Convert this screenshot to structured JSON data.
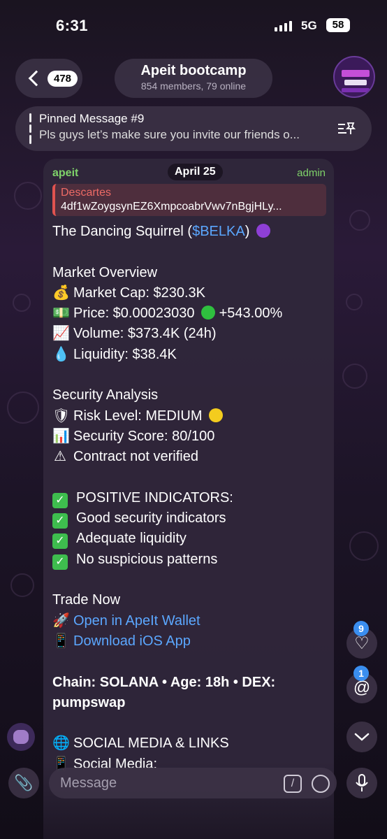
{
  "status_bar": {
    "time": "6:31",
    "network": "5G",
    "battery": "58"
  },
  "header": {
    "back_count": "478",
    "title": "Apeit bootcamp",
    "subtitle": "854 members, 79 online"
  },
  "pinned": {
    "title": "Pinned Message #9",
    "text": "Pls guys let’s make sure you invite our friends o..."
  },
  "message": {
    "sender": "apeit",
    "date": "April 25",
    "role": "admin",
    "reply": {
      "name": "Descartes",
      "text": "4df1wZoygsynEZ6XmpcoabrVwv7nBgjHLy..."
    },
    "token_title_prefix": "The Dancing Squirrel (",
    "token_ticker": "$BELKA",
    "token_title_suffix": ") ",
    "market_heading": "Market Overview",
    "market_cap": "Market Cap: $230.3K",
    "price": "Price: $0.00023030",
    "price_change": "+543.00%",
    "volume": "Volume: $373.4K (24h)",
    "liquidity": "Liquidity: $38.4K",
    "security_heading": "Security Analysis",
    "risk_level": "Risk Level: MEDIUM",
    "security_score": "Security Score: 80/100",
    "contract": "Contract not verified",
    "positive_heading": "POSITIVE INDICATORS:",
    "positive_1": "Good security indicators",
    "positive_2": "Adequate liquidity",
    "positive_3": "No suspicious patterns",
    "trade_heading": "Trade Now",
    "open_wallet": "Open in ApeIt Wallet",
    "download_app": "Download iOS App",
    "chain_line_1": "Chain: SOLANA • Age: 18h • DEX:",
    "chain_line_2": "pumpswap",
    "social_heading": "SOCIAL MEDIA & LINKS",
    "social_media": "Social Media:"
  },
  "side_buttons": {
    "reactions_badge": "9",
    "mentions_badge": "1"
  },
  "composer": {
    "placeholder": "Message"
  },
  "colors": {
    "accent_green": "#7fd36a",
    "link_blue": "#5ba7ff",
    "reply_red": "#e0534f",
    "badge_blue": "#3a8eef"
  }
}
